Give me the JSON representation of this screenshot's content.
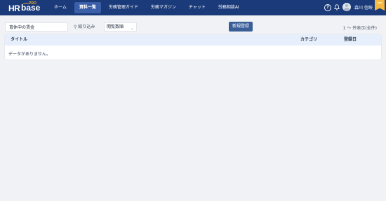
{
  "header": {
    "logo": {
      "hr": "HR",
      "base": "base",
      "pro": "PRO"
    },
    "nav": [
      {
        "label": "ホーム"
      },
      {
        "label": "資料一覧",
        "active": true
      },
      {
        "label": "労務管理ガイド"
      },
      {
        "label": "労務マガジン"
      },
      {
        "label": "チャット"
      },
      {
        "label": "労務相談AI"
      }
    ],
    "help_icon": "question-circle-icon",
    "bell_icon": "bell-icon",
    "username": "森川 信映",
    "plan_badge": "PRO",
    "colors": {
      "bar": "#1a3a7a",
      "active": "#3a5ea8",
      "badge": "#f5b942"
    }
  },
  "toolbar": {
    "search": {
      "value": "育休中の賃金",
      "placeholder": ""
    },
    "filter_label": "絞り込み",
    "sort_label": "閲覧数順",
    "new_button": "新規登録",
    "count_text": "1 ～ 件表示(全件)"
  },
  "table": {
    "columns": [
      "タイトル",
      "カテゴリ",
      "登録日"
    ],
    "empty_message": "データがありません。"
  }
}
